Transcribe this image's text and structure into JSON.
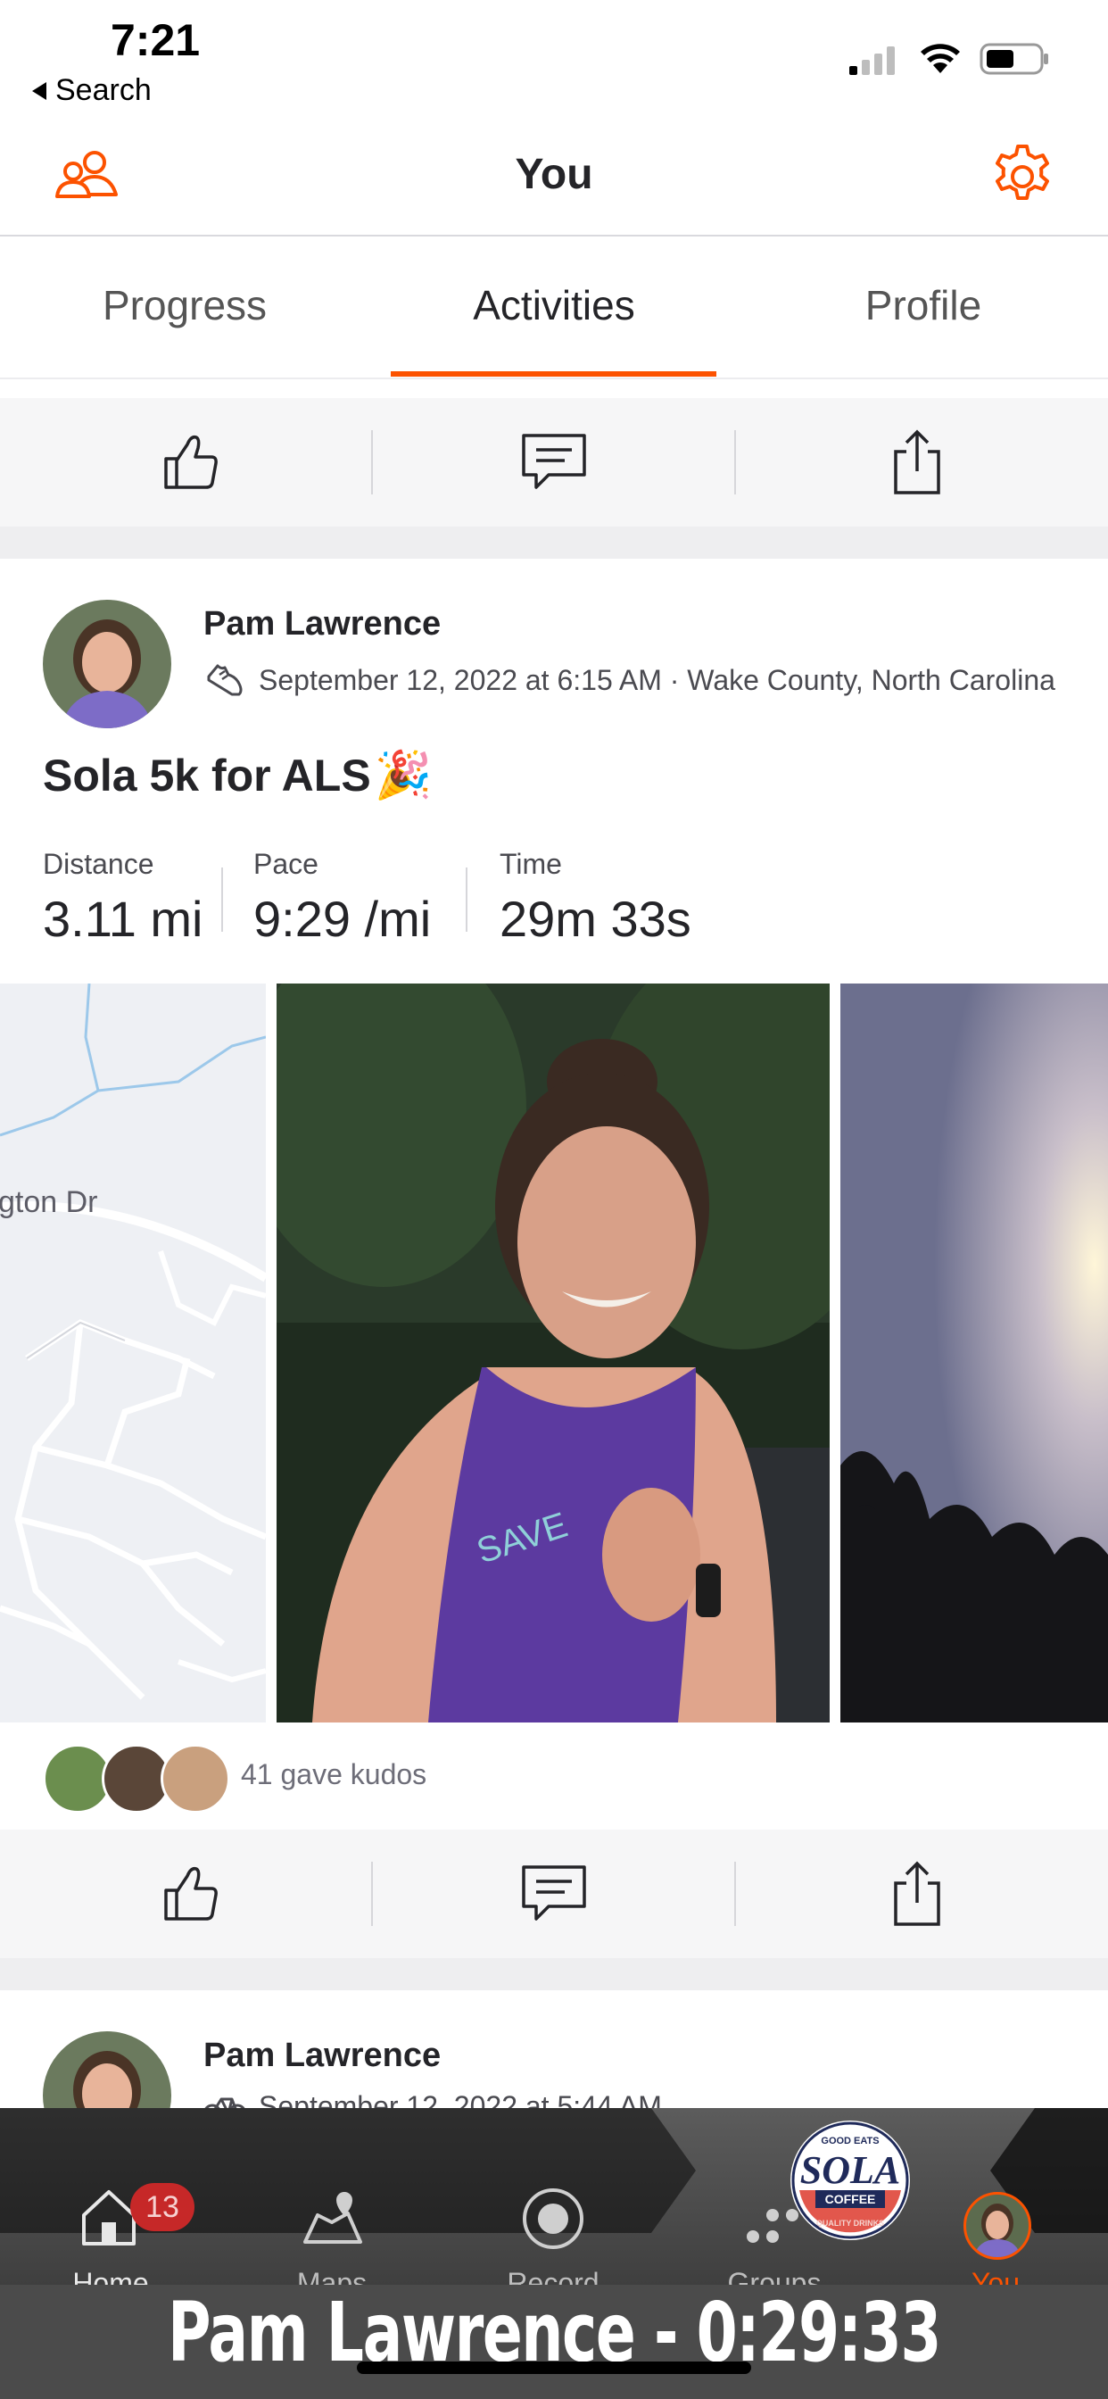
{
  "status_bar": {
    "time": "7:21",
    "back_label": "Search"
  },
  "header": {
    "title": "You"
  },
  "tabs": [
    {
      "label": "Progress",
      "active": false
    },
    {
      "label": "Activities",
      "active": true
    },
    {
      "label": "Profile",
      "active": false
    }
  ],
  "activity1": {
    "athlete": "Pam Lawrence",
    "meta": "September 12, 2022 at 6:15 AM · Wake County, North Carolina",
    "title": "Sola 5k for ALS",
    "title_emoji": "🎉",
    "stats": [
      {
        "label": "Distance",
        "value": "3.11 mi"
      },
      {
        "label": "Pace",
        "value": "9:29 /mi"
      },
      {
        "label": "Time",
        "value": "29m 33s"
      }
    ],
    "map_label": "gton Dr",
    "kudos_text": "41 gave kudos"
  },
  "activity2": {
    "athlete": "Pam Lawrence",
    "meta": "September 12, 2022 at 5:44 AM"
  },
  "nav": {
    "home_label": "Home",
    "home_badge": "13",
    "maps_label": "Maps",
    "record_label": "Record",
    "groups_label": "Groups",
    "you_label": "You"
  },
  "sponsor": {
    "top_text": "GOOD EATS",
    "name": "SOLA",
    "banner": "COFFEE",
    "bottom_text": "QUALITY DRINKS"
  },
  "overlay": {
    "caption": "Pam Lawrence - 0:29:33"
  },
  "colors": {
    "accent": "#fc5200",
    "text": "#242428",
    "muted": "#6d6d78",
    "badge": "#c62828"
  }
}
